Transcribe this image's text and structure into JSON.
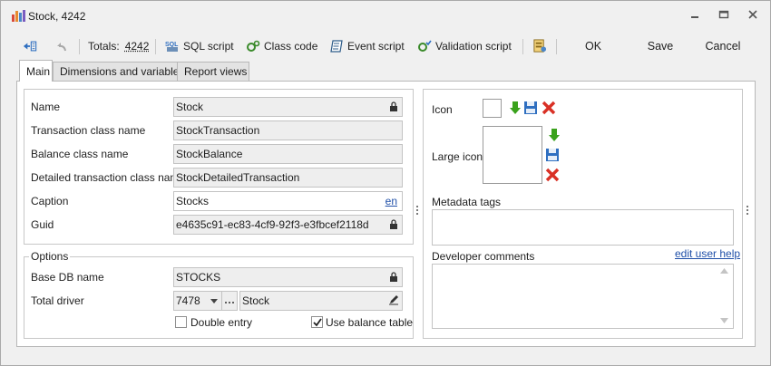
{
  "window": {
    "title": "Stock, 4242"
  },
  "toolbar": {
    "totals_label": "Totals:",
    "totals_value": "4242",
    "sql_script": "SQL script",
    "class_code": "Class code",
    "event_script": "Event script",
    "validation_script": "Validation script",
    "ok": "OK",
    "save": "Save",
    "cancel": "Cancel"
  },
  "tabs": [
    "Main",
    "Dimensions and variables",
    "Report views"
  ],
  "main": {
    "name_label": "Name",
    "name_value": "Stock",
    "transaction_label": "Transaction class name",
    "transaction_value": "StockTransaction",
    "balance_label": "Balance class name",
    "balance_value": "StockBalance",
    "detailed_label": "Detailed transaction class name",
    "detailed_value": "StockDetailedTransaction",
    "caption_label": "Caption",
    "caption_value": "Stocks",
    "caption_lang": "en",
    "guid_label": "Guid",
    "guid_value": "e4635c91-ec83-4cf9-92f3-e3fbcef2118d"
  },
  "options": {
    "group_label": "Options",
    "base_db_label": "Base DB name",
    "base_db_value": "STOCKS",
    "total_driver_label": "Total driver",
    "total_driver_id": "7478",
    "total_driver_name": "Stock",
    "double_entry_label": "Double entry",
    "double_entry_checked": false,
    "use_balance_label": "Use balance table",
    "use_balance_checked": true
  },
  "right": {
    "icon_label": "Icon",
    "large_icon_label": "Large icon",
    "metadata_tags_label": "Metadata tags",
    "metadata_tags_value": "",
    "developer_comments_label": "Developer comments",
    "developer_comments_value": "",
    "edit_user_help": "edit user help"
  },
  "colors": {
    "link": "#1f4fa8",
    "accent_green": "#3aa21c",
    "delete_red": "#d93025"
  }
}
